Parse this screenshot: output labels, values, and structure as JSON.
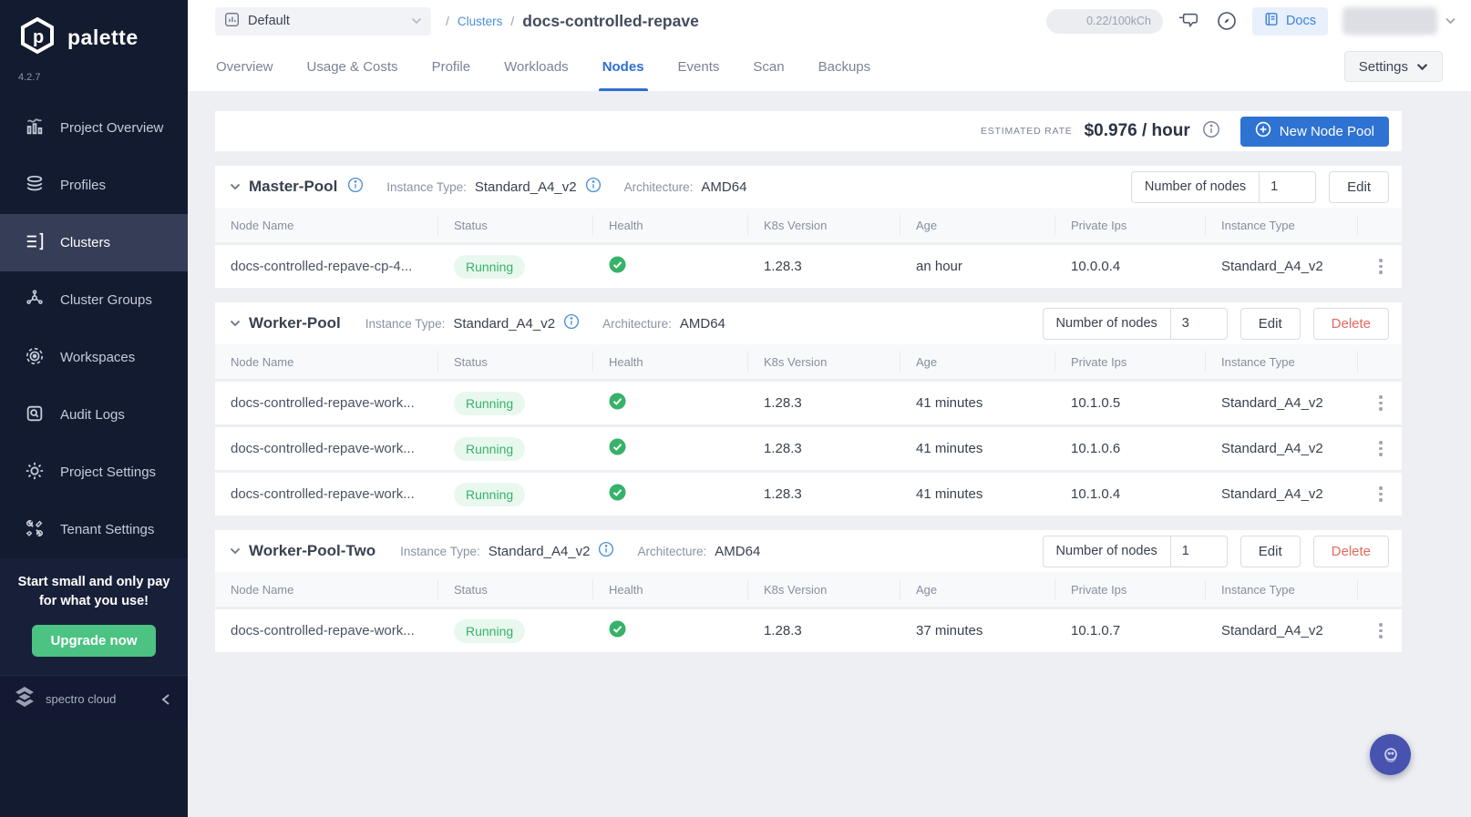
{
  "colors": {
    "sidebar_bg": "#131b31",
    "sidebar_active_bg": "#363d56",
    "accent_blue": "#2f6fd3",
    "button_blue": "#2e72d2",
    "link_blue": "#4a90d9",
    "success_green": "#36b26a",
    "upgrade_green": "#4cc283",
    "danger_red": "#e4695e",
    "page_bg": "#edeff3",
    "fab_indigo": "#4753af"
  },
  "sidebar": {
    "brand": "palette",
    "version": "4.2.7",
    "items": [
      {
        "label": "Project Overview"
      },
      {
        "label": "Profiles"
      },
      {
        "label": "Clusters"
      },
      {
        "label": "Cluster Groups"
      },
      {
        "label": "Workspaces"
      },
      {
        "label": "Audit Logs"
      },
      {
        "label": "Project Settings"
      },
      {
        "label": "Tenant Settings"
      }
    ],
    "active_item": "Clusters",
    "promo_text": "Start small and only pay for what you use!",
    "upgrade_label": "Upgrade now",
    "footer_brand": "spectro cloud"
  },
  "topbar": {
    "project_selector": "Default",
    "breadcrumb_sep": "/",
    "breadcrumb_link": "Clusters",
    "page_title": "docs-controlled-repave",
    "usage_badge": "0.22/100kCh",
    "docs_label": "Docs"
  },
  "tabs": {
    "items": [
      "Overview",
      "Usage & Costs",
      "Profile",
      "Workloads",
      "Nodes",
      "Events",
      "Scan",
      "Backups"
    ],
    "active": "Nodes",
    "settings_label": "Settings"
  },
  "rate_bar": {
    "label": "ESTIMATED RATE",
    "value": "$0.976 / hour",
    "new_pool_label": "New Node Pool"
  },
  "labels": {
    "instance_type": "Instance Type:",
    "architecture": "Architecture:",
    "number_of_nodes": "Number of nodes",
    "edit": "Edit",
    "delete": "Delete"
  },
  "table_headers": [
    "Node Name",
    "Status",
    "Health",
    "K8s Version",
    "Age",
    "Private Ips",
    "Instance Type"
  ],
  "pools": [
    {
      "name": "Master-Pool",
      "instance_type": "Standard_A4_v2",
      "architecture": "AMD64",
      "nodes_count": "1",
      "rows": [
        {
          "name": "docs-controlled-repave-cp-4...",
          "status": "Running",
          "k8s_version": "1.28.3",
          "age": "an hour",
          "private_ip": "10.0.0.4",
          "instance_type": "Standard_A4_v2"
        }
      ]
    },
    {
      "name": "Worker-Pool",
      "instance_type": "Standard_A4_v2",
      "architecture": "AMD64",
      "nodes_count": "3",
      "rows": [
        {
          "name": "docs-controlled-repave-work...",
          "status": "Running",
          "k8s_version": "1.28.3",
          "age": "41 minutes",
          "private_ip": "10.1.0.5",
          "instance_type": "Standard_A4_v2"
        },
        {
          "name": "docs-controlled-repave-work...",
          "status": "Running",
          "k8s_version": "1.28.3",
          "age": "41 minutes",
          "private_ip": "10.1.0.6",
          "instance_type": "Standard_A4_v2"
        },
        {
          "name": "docs-controlled-repave-work...",
          "status": "Running",
          "k8s_version": "1.28.3",
          "age": "41 minutes",
          "private_ip": "10.1.0.4",
          "instance_type": "Standard_A4_v2"
        }
      ]
    },
    {
      "name": "Worker-Pool-Two",
      "instance_type": "Standard_A4_v2",
      "architecture": "AMD64",
      "nodes_count": "1",
      "rows": [
        {
          "name": "docs-controlled-repave-work...",
          "status": "Running",
          "k8s_version": "1.28.3",
          "age": "37 minutes",
          "private_ip": "10.1.0.7",
          "instance_type": "Standard_A4_v2"
        }
      ]
    }
  ]
}
